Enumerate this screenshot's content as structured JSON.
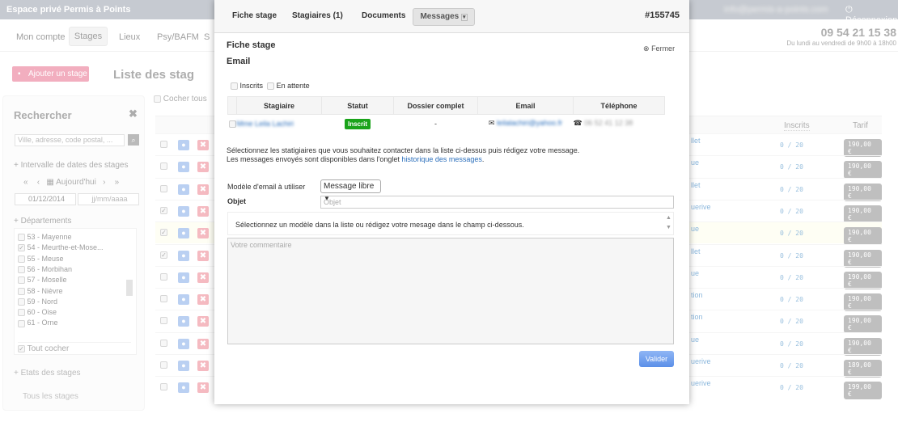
{
  "app": {
    "title": "Espace privé Permis à Points",
    "user_email": "info@permis-a-points.com",
    "logout": "Déconnexion",
    "phone": "09 54 21 15 38",
    "hours": "Du lundi au vendredi de 9h00 à 18h00"
  },
  "nav": [
    "Mon compte",
    "Stages",
    "Lieux",
    "Psy/BAFM",
    "S"
  ],
  "add_button": "Ajouter un stage",
  "list_title": "Liste des stag",
  "check_all": "Cocher tous",
  "sidebar": {
    "title": "Rechercher",
    "search_placeholder": "Ville, adresse, code postal, ...",
    "date_section": "Intervalle de dates des stages",
    "today": "Aujourd'hui",
    "date_from": "01/12/2014",
    "date_to_placeholder": "jj/mm/aaaa",
    "dept_section": "Départements",
    "departments": [
      {
        "label": "53 - Mayenne",
        "checked": false
      },
      {
        "label": "54 - Meurthe-et-Mose...",
        "checked": true
      },
      {
        "label": "55 - Meuse",
        "checked": false
      },
      {
        "label": "56 - Morbihan",
        "checked": false
      },
      {
        "label": "57 - Moselle",
        "checked": false
      },
      {
        "label": "58 - Nièvre",
        "checked": false
      },
      {
        "label": "59 - Nord",
        "checked": false
      },
      {
        "label": "60 - Oise",
        "checked": false
      },
      {
        "label": "61 - Orne",
        "checked": false
      }
    ],
    "check_all": "Tout cocher",
    "states_section": "Etats des stages",
    "all_stages": "Tous les stages"
  },
  "table": {
    "headers": [
      "Inscrits",
      "Tarif"
    ],
    "rows": [
      {
        "lieu": "llet",
        "inscrits": "0 / 20",
        "tarif": "190,00 €",
        "checked": false
      },
      {
        "lieu": "ue",
        "inscrits": "0 / 20",
        "tarif": "190,00 €",
        "checked": false
      },
      {
        "lieu": "llet",
        "inscrits": "0 / 20",
        "tarif": "190,00 €",
        "checked": false
      },
      {
        "lieu": "uerive",
        "inscrits": "0 / 20",
        "tarif": "190,00 €",
        "checked": true
      },
      {
        "lieu": "ue",
        "inscrits": "0 / 20",
        "tarif": "190,00 €",
        "checked": true,
        "highlight": true
      },
      {
        "lieu": "llet",
        "inscrits": "0 / 20",
        "tarif": "190,00 €",
        "checked": true
      },
      {
        "lieu": "ue",
        "inscrits": "0 / 20",
        "tarif": "190,00 €",
        "checked": false
      },
      {
        "lieu": "tion",
        "inscrits": "0 / 20",
        "tarif": "190,00 €",
        "checked": false
      },
      {
        "lieu": "tion",
        "inscrits": "0 / 20",
        "tarif": "190,00 €",
        "checked": false
      },
      {
        "lieu": "ue",
        "inscrits": "0 / 20",
        "tarif": "190,00 €",
        "checked": false
      },
      {
        "lieu": "uerive",
        "inscrits": "0 / 20",
        "tarif": "189,00 €",
        "checked": false
      },
      {
        "lieu": "uerive",
        "inscrits": "0 / 20",
        "tarif": "199,00 €",
        "checked": false
      }
    ]
  },
  "modal": {
    "tabs": [
      "Fiche stage",
      "Stagiaires (1)",
      "Documents",
      "Messages"
    ],
    "ref": "#155745",
    "title": "Fiche stage",
    "close": "Fermer",
    "subtitle": "Email",
    "filters": [
      "Inscrits",
      "En attente"
    ],
    "columns": [
      "Stagiaire",
      "Statut",
      "Dossier complet",
      "Email",
      "Téléphone"
    ],
    "row": {
      "name": "Mme Leila Lachiri",
      "status": "Inscrit",
      "dossier": "-",
      "email": "leilalachiri@yahoo.fr",
      "phone": "06 52 41 12 38"
    },
    "help1": "Sélectionnez les statigiaires que vous souhaitez contacter dans la liste ci-dessus puis rédigez votre message.",
    "help2_pre": "Les messages envoyés sont disponibles dans l'onglet ",
    "help2_link": "historique des messages",
    "help2_post": ".",
    "template_label": "Modèle d'email à utiliser",
    "template_value": "Message libre",
    "subject_label": "Objet",
    "subject_placeholder": "Objet",
    "info": "Sélectionnez un modèle dans la liste ou rédigez votre mesage dans le champ ci-dessous.",
    "comment_placeholder": "Votre commentaire",
    "submit": "Valider"
  },
  "colors": {
    "status_inscrit": "#1aa31a",
    "submit": "#5b8fe8",
    "add_button": "#f5b8c6"
  }
}
